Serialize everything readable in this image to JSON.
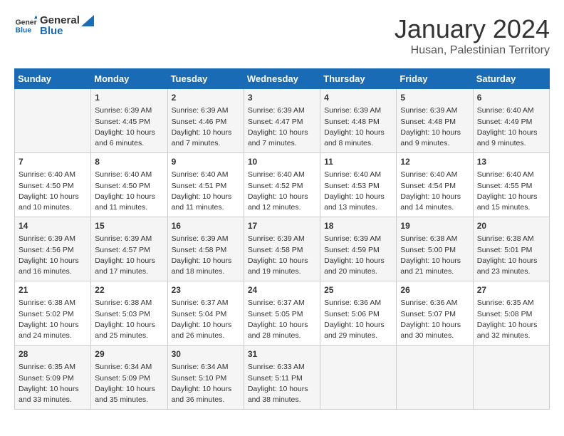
{
  "header": {
    "logo_line1": "General",
    "logo_line2": "Blue",
    "month_year": "January 2024",
    "location": "Husan, Palestinian Territory"
  },
  "days_of_week": [
    "Sunday",
    "Monday",
    "Tuesday",
    "Wednesday",
    "Thursday",
    "Friday",
    "Saturday"
  ],
  "weeks": [
    [
      {
        "day": "",
        "content": ""
      },
      {
        "day": "1",
        "content": "Sunrise: 6:39 AM\nSunset: 4:45 PM\nDaylight: 10 hours\nand 6 minutes."
      },
      {
        "day": "2",
        "content": "Sunrise: 6:39 AM\nSunset: 4:46 PM\nDaylight: 10 hours\nand 7 minutes."
      },
      {
        "day": "3",
        "content": "Sunrise: 6:39 AM\nSunset: 4:47 PM\nDaylight: 10 hours\nand 7 minutes."
      },
      {
        "day": "4",
        "content": "Sunrise: 6:39 AM\nSunset: 4:48 PM\nDaylight: 10 hours\nand 8 minutes."
      },
      {
        "day": "5",
        "content": "Sunrise: 6:39 AM\nSunset: 4:48 PM\nDaylight: 10 hours\nand 9 minutes."
      },
      {
        "day": "6",
        "content": "Sunrise: 6:40 AM\nSunset: 4:49 PM\nDaylight: 10 hours\nand 9 minutes."
      }
    ],
    [
      {
        "day": "7",
        "content": "Sunrise: 6:40 AM\nSunset: 4:50 PM\nDaylight: 10 hours\nand 10 minutes."
      },
      {
        "day": "8",
        "content": "Sunrise: 6:40 AM\nSunset: 4:50 PM\nDaylight: 10 hours\nand 11 minutes."
      },
      {
        "day": "9",
        "content": "Sunrise: 6:40 AM\nSunset: 4:51 PM\nDaylight: 10 hours\nand 11 minutes."
      },
      {
        "day": "10",
        "content": "Sunrise: 6:40 AM\nSunset: 4:52 PM\nDaylight: 10 hours\nand 12 minutes."
      },
      {
        "day": "11",
        "content": "Sunrise: 6:40 AM\nSunset: 4:53 PM\nDaylight: 10 hours\nand 13 minutes."
      },
      {
        "day": "12",
        "content": "Sunrise: 6:40 AM\nSunset: 4:54 PM\nDaylight: 10 hours\nand 14 minutes."
      },
      {
        "day": "13",
        "content": "Sunrise: 6:40 AM\nSunset: 4:55 PM\nDaylight: 10 hours\nand 15 minutes."
      }
    ],
    [
      {
        "day": "14",
        "content": "Sunrise: 6:39 AM\nSunset: 4:56 PM\nDaylight: 10 hours\nand 16 minutes."
      },
      {
        "day": "15",
        "content": "Sunrise: 6:39 AM\nSunset: 4:57 PM\nDaylight: 10 hours\nand 17 minutes."
      },
      {
        "day": "16",
        "content": "Sunrise: 6:39 AM\nSunset: 4:58 PM\nDaylight: 10 hours\nand 18 minutes."
      },
      {
        "day": "17",
        "content": "Sunrise: 6:39 AM\nSunset: 4:58 PM\nDaylight: 10 hours\nand 19 minutes."
      },
      {
        "day": "18",
        "content": "Sunrise: 6:39 AM\nSunset: 4:59 PM\nDaylight: 10 hours\nand 20 minutes."
      },
      {
        "day": "19",
        "content": "Sunrise: 6:38 AM\nSunset: 5:00 PM\nDaylight: 10 hours\nand 21 minutes."
      },
      {
        "day": "20",
        "content": "Sunrise: 6:38 AM\nSunset: 5:01 PM\nDaylight: 10 hours\nand 23 minutes."
      }
    ],
    [
      {
        "day": "21",
        "content": "Sunrise: 6:38 AM\nSunset: 5:02 PM\nDaylight: 10 hours\nand 24 minutes."
      },
      {
        "day": "22",
        "content": "Sunrise: 6:38 AM\nSunset: 5:03 PM\nDaylight: 10 hours\nand 25 minutes."
      },
      {
        "day": "23",
        "content": "Sunrise: 6:37 AM\nSunset: 5:04 PM\nDaylight: 10 hours\nand 26 minutes."
      },
      {
        "day": "24",
        "content": "Sunrise: 6:37 AM\nSunset: 5:05 PM\nDaylight: 10 hours\nand 28 minutes."
      },
      {
        "day": "25",
        "content": "Sunrise: 6:36 AM\nSunset: 5:06 PM\nDaylight: 10 hours\nand 29 minutes."
      },
      {
        "day": "26",
        "content": "Sunrise: 6:36 AM\nSunset: 5:07 PM\nDaylight: 10 hours\nand 30 minutes."
      },
      {
        "day": "27",
        "content": "Sunrise: 6:35 AM\nSunset: 5:08 PM\nDaylight: 10 hours\nand 32 minutes."
      }
    ],
    [
      {
        "day": "28",
        "content": "Sunrise: 6:35 AM\nSunset: 5:09 PM\nDaylight: 10 hours\nand 33 minutes."
      },
      {
        "day": "29",
        "content": "Sunrise: 6:34 AM\nSunset: 5:09 PM\nDaylight: 10 hours\nand 35 minutes."
      },
      {
        "day": "30",
        "content": "Sunrise: 6:34 AM\nSunset: 5:10 PM\nDaylight: 10 hours\nand 36 minutes."
      },
      {
        "day": "31",
        "content": "Sunrise: 6:33 AM\nSunset: 5:11 PM\nDaylight: 10 hours\nand 38 minutes."
      },
      {
        "day": "",
        "content": ""
      },
      {
        "day": "",
        "content": ""
      },
      {
        "day": "",
        "content": ""
      }
    ]
  ]
}
